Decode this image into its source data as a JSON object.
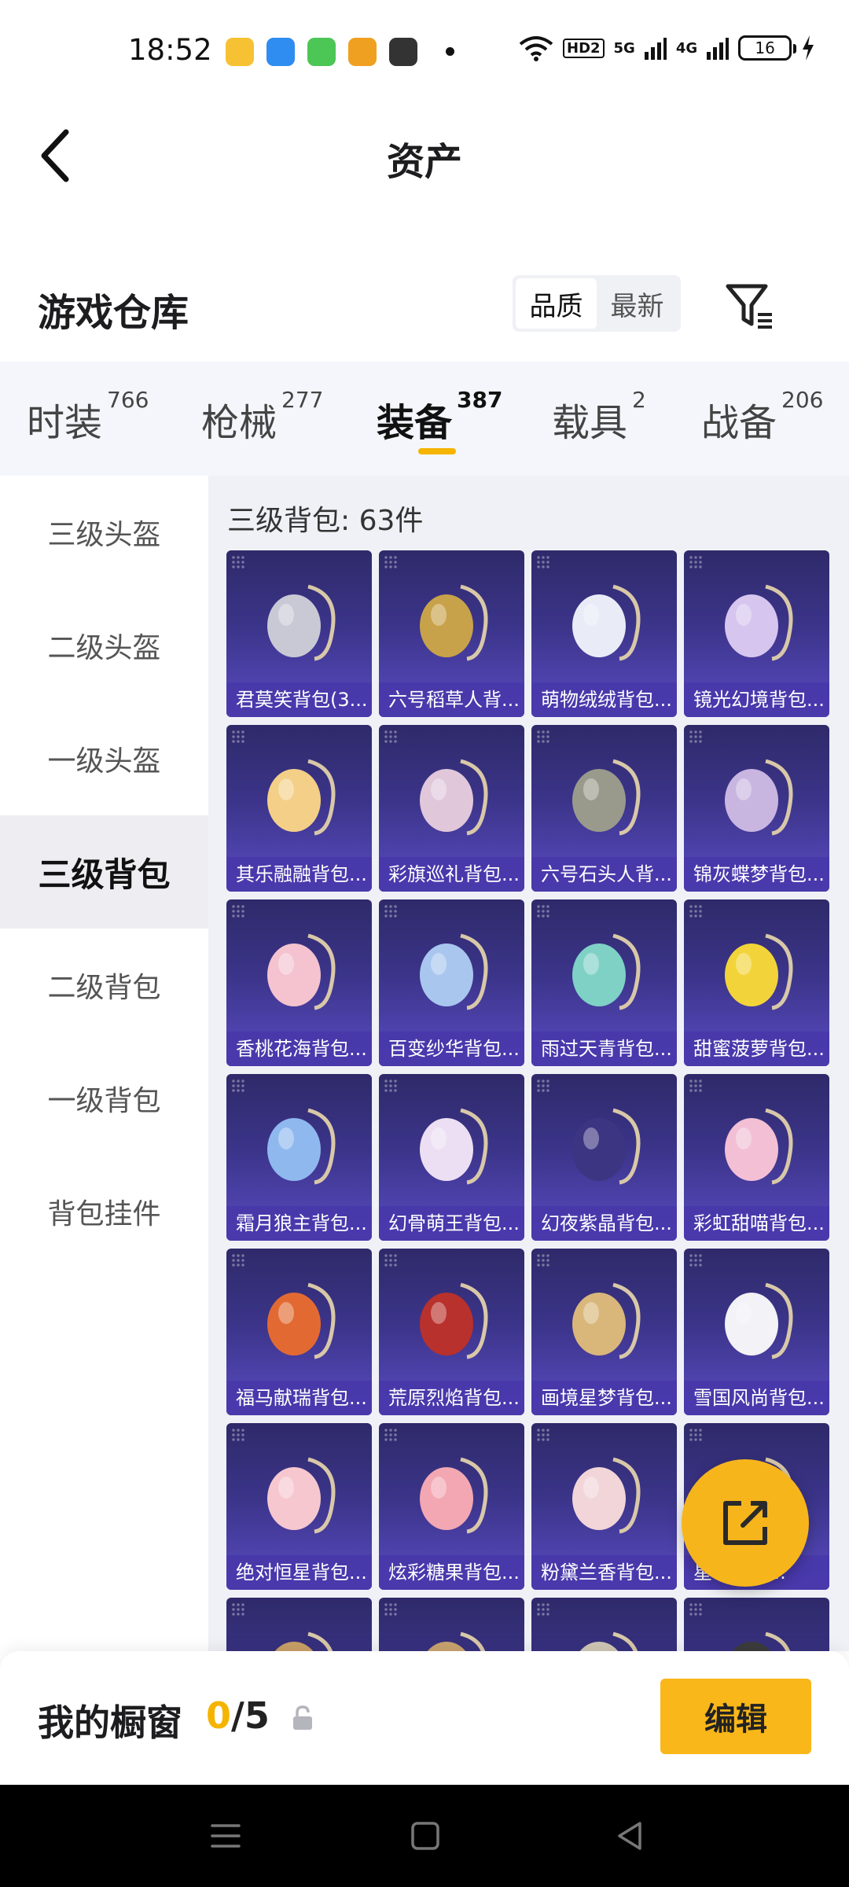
{
  "status_bar": {
    "time": "18:52",
    "app_icons": [
      {
        "name": "app-icon-1",
        "color": "#f6c233"
      },
      {
        "name": "app-icon-2",
        "color": "#2f8cf0"
      },
      {
        "name": "app-icon-3",
        "color": "#4cc655"
      },
      {
        "name": "app-icon-4",
        "color": "#f0a020"
      },
      {
        "name": "app-icon-5",
        "color": "#333333"
      }
    ],
    "hd_label": "HD2",
    "net1": "5G",
    "net2": "4G",
    "battery": "16"
  },
  "header": {
    "title": "资产"
  },
  "warehouse": {
    "title": "游戏仓库",
    "sort_options": [
      "品质",
      "最新"
    ]
  },
  "tabs": [
    {
      "label": "时装",
      "count": "766"
    },
    {
      "label": "枪械",
      "count": "277"
    },
    {
      "label": "装备",
      "count": "387"
    },
    {
      "label": "载具",
      "count": "2"
    },
    {
      "label": "战备",
      "count": "206"
    }
  ],
  "sidebar": {
    "items": [
      "三级头盔",
      "二级头盔",
      "一级头盔",
      "三级背包",
      "二级背包",
      "一级背包",
      "背包挂件"
    ]
  },
  "content": {
    "group_title": "三级背包: 63件",
    "items": [
      {
        "label": "君莫笑背包(3...",
        "color": "#c9c9d6"
      },
      {
        "label": "六号稻草人背...",
        "color": "#c8a24a"
      },
      {
        "label": "萌物绒绒背包...",
        "color": "#e9ecf6"
      },
      {
        "label": "镜光幻境背包...",
        "color": "#d6c5ef"
      },
      {
        "label": "其乐融融背包...",
        "color": "#f3cf88"
      },
      {
        "label": "彩旗巡礼背包...",
        "color": "#e0c7da"
      },
      {
        "label": "六号石头人背...",
        "color": "#9a9a8c"
      },
      {
        "label": "锦灰蝶梦背包...",
        "color": "#c8b5e0"
      },
      {
        "label": "香桃花海背包...",
        "color": "#f4c3cf"
      },
      {
        "label": "百变纱华背包...",
        "color": "#a9c6ef"
      },
      {
        "label": "雨过天青背包...",
        "color": "#7fd1c6"
      },
      {
        "label": "甜蜜菠萝背包...",
        "color": "#f2d43a"
      },
      {
        "label": "霜月狼主背包...",
        "color": "#8fb8ef"
      },
      {
        "label": "幻骨萌王背包...",
        "color": "#ecdff3"
      },
      {
        "label": "幻夜紫晶背包...",
        "color": "#3c3582"
      },
      {
        "label": "彩虹甜喵背包...",
        "color": "#f2bfd4"
      },
      {
        "label": "福马献瑞背包...",
        "color": "#e26a32"
      },
      {
        "label": "荒原烈焰背包...",
        "color": "#b8312c"
      },
      {
        "label": "画境星梦背包...",
        "color": "#d9b77a"
      },
      {
        "label": "雪国风尚背包...",
        "color": "#f2f2f7"
      },
      {
        "label": "绝对恒星背包...",
        "color": "#f6c7cf"
      },
      {
        "label": "炫彩糖果背包...",
        "color": "#f3a7b2"
      },
      {
        "label": "粉黛兰香背包...",
        "color": "#f1d5d8"
      },
      {
        "label": "星...背包...",
        "color": "#d7c2a6"
      },
      {
        "label": "",
        "color": "#c8a066"
      },
      {
        "label": "",
        "color": "#c9a36f"
      },
      {
        "label": "",
        "color": "#cfc6b5"
      },
      {
        "label": "",
        "color": "#3b3b3b"
      }
    ]
  },
  "bottom": {
    "showcase_title": "我的橱窗",
    "showcase_current": "0",
    "showcase_total": "/5",
    "edit_label": "编辑"
  }
}
